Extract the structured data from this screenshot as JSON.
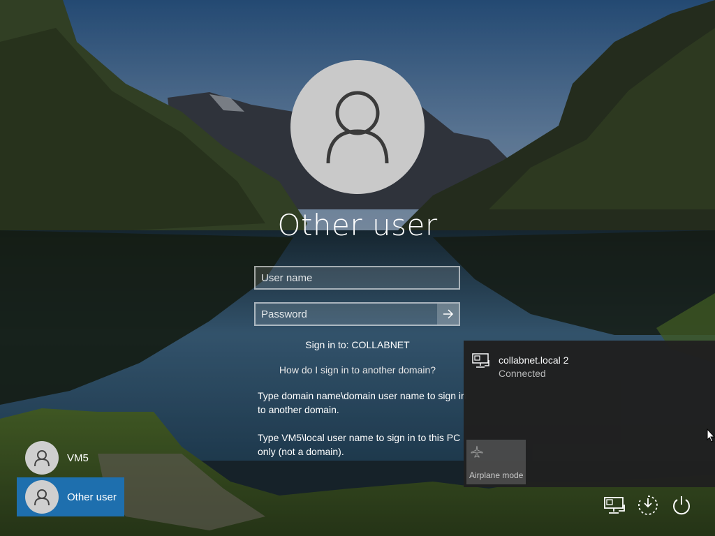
{
  "login": {
    "title": "Other user",
    "username_placeholder": "User name",
    "password_placeholder": "Password",
    "sign_in_to": "Sign in to: COLLABNET",
    "other_domain_link": "How do I sign in to another domain?",
    "help_text_1": "Type domain name\\domain user name to sign in to another domain.",
    "help_text_2": "Type VM5\\local user name to sign in to this PC only (not a domain)."
  },
  "users": [
    {
      "name": "VM5",
      "selected": false
    },
    {
      "name": "Other user",
      "selected": true
    }
  ],
  "network_flyout": {
    "network_name": "collabnet.local 2",
    "network_status": "Connected",
    "airplane_label": "Airplane mode",
    "network_icon": "ethernet-icon",
    "airplane_icon": "airplane-icon"
  },
  "tray": {
    "icons": [
      "network-icon",
      "ease-of-access-icon",
      "power-icon"
    ]
  },
  "colors": {
    "selected_user": "#1e6fae",
    "flyout_bg": "#202020",
    "airplane_tile": "#4a4a4a"
  }
}
